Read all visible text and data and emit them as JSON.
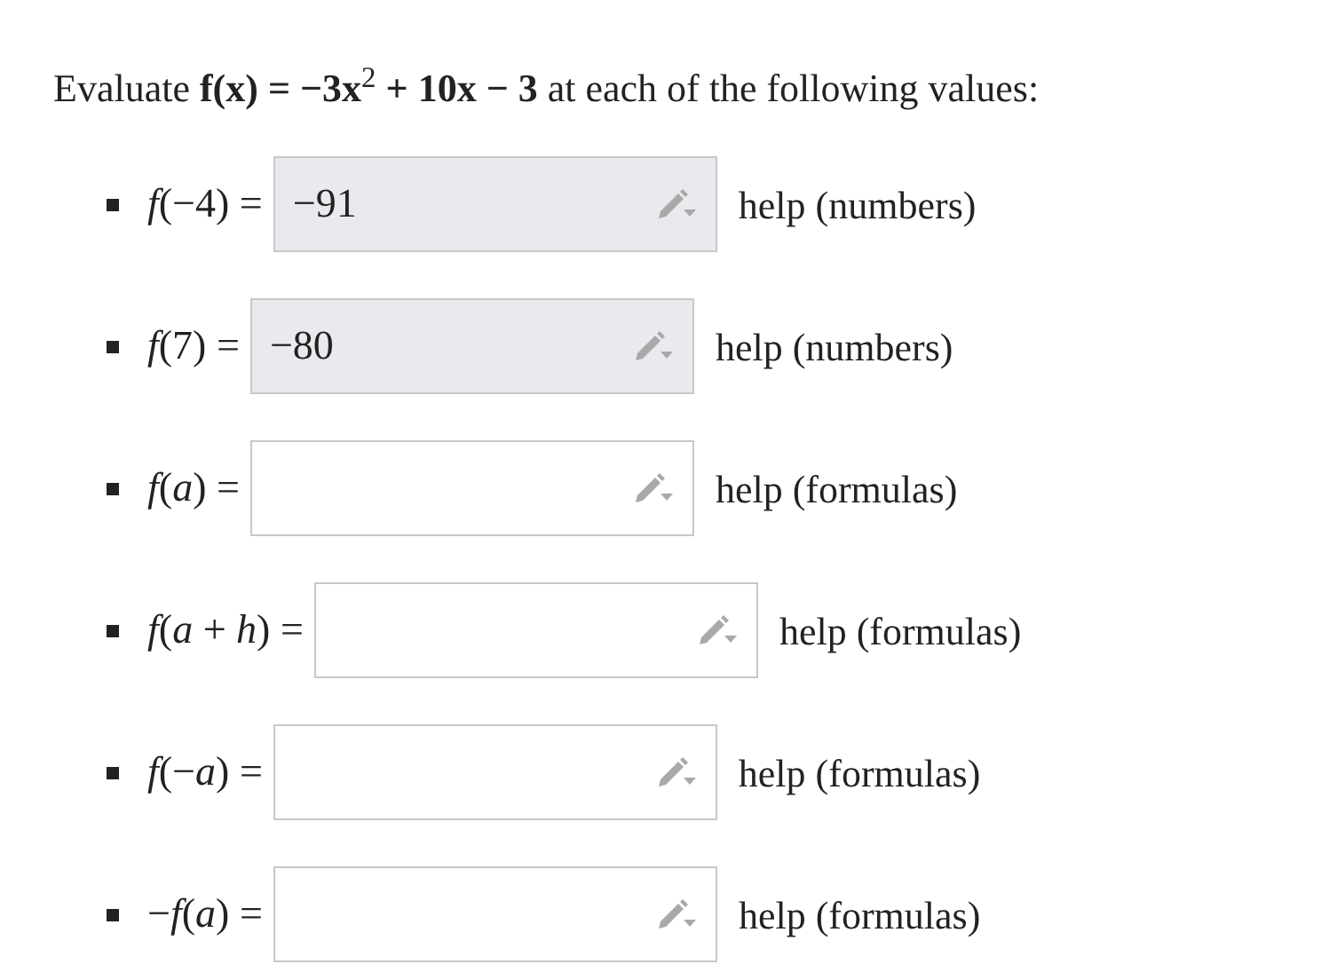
{
  "prompt": "Evaluate **f(x) = −3x**$^{2}$ **+ 10x − 3** at each of the following values:",
  "items": [
    {
      "label": "*f*(−4) =",
      "value": "−91",
      "help": "help (numbers)"
    },
    {
      "label": "*f*(7) =",
      "value": "−80",
      "help": "help (numbers)"
    },
    {
      "label": "*f*(*a*) =",
      "value": "",
      "help": "help (formulas)"
    },
    {
      "label": "*f*(*a* + *h*) =",
      "value": "",
      "help": "help (formulas)"
    },
    {
      "label": "*f*(−*a*) =",
      "value": "",
      "help": "help (formulas)"
    },
    {
      "label": "−*f*(*a*) =",
      "value": "",
      "help": "help (formulas)"
    }
  ]
}
